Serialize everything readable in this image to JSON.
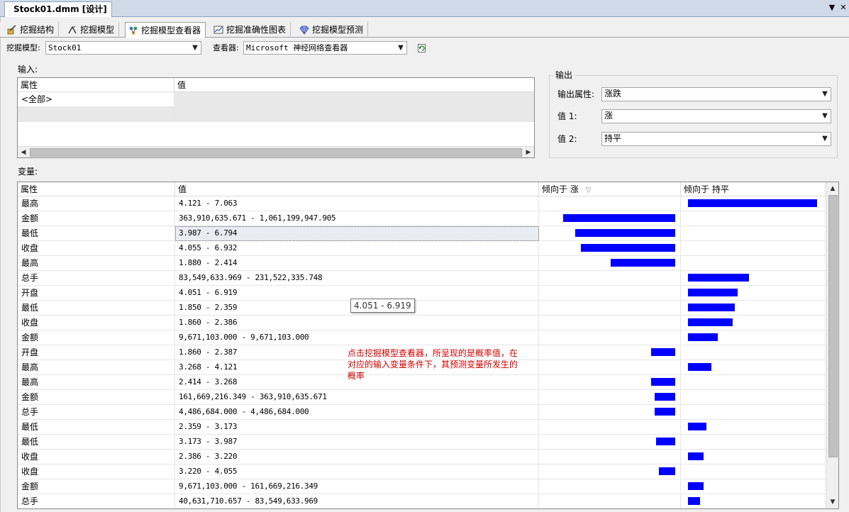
{
  "doc_tab": {
    "title": "Stock01.dmm [设计]"
  },
  "window_controls": {
    "dropdown_glyph": "▼",
    "close_glyph": "✕"
  },
  "designer_tabs": [
    {
      "label": "挖掘结构",
      "icon": "mining-structure-icon",
      "active": false
    },
    {
      "label": "挖掘模型",
      "icon": "mining-model-icon",
      "active": false
    },
    {
      "label": "挖掘模型查看器",
      "icon": "model-viewer-icon",
      "active": true
    },
    {
      "label": "挖掘准确性图表",
      "icon": "accuracy-chart-icon",
      "active": false
    },
    {
      "label": "挖掘模型预测",
      "icon": "model-prediction-icon",
      "active": false
    }
  ],
  "toolbar": {
    "model_label": "挖掘模型:",
    "model_value": "Stock01",
    "viewer_label": "查看器:",
    "viewer_value": "Microsoft 神经网络查看器",
    "refresh_icon": "refresh-icon"
  },
  "input": {
    "label": "输入:",
    "col_attr": "属性",
    "col_value": "值",
    "rows": [
      {
        "attr": "<全部>",
        "value": ""
      },
      {
        "attr": "",
        "value": ""
      }
    ]
  },
  "output": {
    "label": "输出",
    "attr_label": "输出属性:",
    "attr_value": "涨跌",
    "v1_label": "值 1:",
    "v1_value": "涨",
    "v2_label": "值 2:",
    "v2_value": "持平"
  },
  "variables": {
    "label": "变量:",
    "col_attr": "属性",
    "col_value": "值",
    "col_favors_a": "倾向于 涨",
    "col_favors_b": "倾向于 持平",
    "sort_glyph": "▽",
    "rows": [
      {
        "attr": "最高",
        "value": "4.121 - 7.063",
        "fa": 0,
        "fb": 0.99
      },
      {
        "attr": "金额",
        "value": "363,910,635.671 - 1,061,199,947.905",
        "fa": 0.83,
        "fb": 0
      },
      {
        "attr": "最低",
        "value": "3.987 - 6.794",
        "fa": 0.74,
        "fb": 0
      },
      {
        "attr": "收盘",
        "value": "4.055 - 6.932",
        "fa": 0.7,
        "fb": 0
      },
      {
        "attr": "最高",
        "value": "1.880 - 2.414",
        "fa": 0.48,
        "fb": 0
      },
      {
        "attr": "总手",
        "value": "83,549,633.969 - 231,522,335.748",
        "fa": 0,
        "fb": 0.47
      },
      {
        "attr": "开盘",
        "value": "4.051 - 6.919",
        "fa": 0,
        "fb": 0.38
      },
      {
        "attr": "最低",
        "value": "1.850 - 2.359",
        "fa": 0,
        "fb": 0.36
      },
      {
        "attr": "收盘",
        "value": "1.860 - 2.386",
        "fa": 0,
        "fb": 0.34
      },
      {
        "attr": "金额",
        "value": "9,671,103.000 - 9,671,103.000",
        "fa": 0,
        "fb": 0.23
      },
      {
        "attr": "开盘",
        "value": "1.860 - 2.387",
        "fa": 0.18,
        "fb": 0
      },
      {
        "attr": "最高",
        "value": "3.268 - 4.121",
        "fa": 0,
        "fb": 0.18
      },
      {
        "attr": "最高",
        "value": "2.414 - 3.268",
        "fa": 0.18,
        "fb": 0
      },
      {
        "attr": "金额",
        "value": "161,669,216.349 - 363,910,635.671",
        "fa": 0.15,
        "fb": 0
      },
      {
        "attr": "总手",
        "value": "4,486,684.000 - 4,486,684.000",
        "fa": 0.15,
        "fb": 0
      },
      {
        "attr": "最低",
        "value": "2.359 - 3.173",
        "fa": 0,
        "fb": 0.14
      },
      {
        "attr": "最低",
        "value": "3.173 - 3.987",
        "fa": 0.14,
        "fb": 0
      },
      {
        "attr": "收盘",
        "value": "2.386 - 3.220",
        "fa": 0,
        "fb": 0.12
      },
      {
        "attr": "收盘",
        "value": "3.220 - 4.055",
        "fa": 0.12,
        "fb": 0
      },
      {
        "attr": "金额",
        "value": "9,671,103.000 - 161,669,216.349",
        "fa": 0,
        "fb": 0.12
      },
      {
        "attr": "总手",
        "value": "40,631,710.657 - 83,549,633.969",
        "fa": 0,
        "fb": 0.09
      }
    ]
  },
  "tooltip": {
    "text": "4.051 - 6.919"
  },
  "annotation": {
    "text": "点击挖掘模型查看器，所呈现的是概率值，在对应的输入变量条件下，其预测变量所发生的概率"
  },
  "colors": {
    "bar": "#0000ff",
    "annotation": "#d00000",
    "selected_row": "#e9ecf2"
  }
}
